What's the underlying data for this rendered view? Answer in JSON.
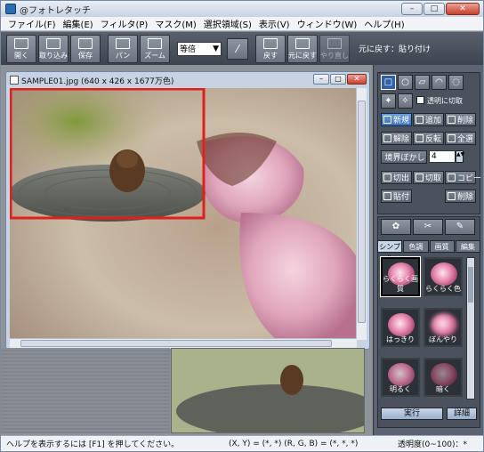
{
  "window": {
    "title": "@フォトレタッチ",
    "min": "–",
    "max": "□",
    "close": "✕"
  },
  "menu": [
    "ファイル(F)",
    "編集(E)",
    "フィルタ(P)",
    "マスク(M)",
    "選択領域(S)",
    "表示(V)",
    "ウィンドウ(W)",
    "ヘルプ(H)"
  ],
  "toolbar": {
    "open": "開く",
    "import": "取り込み",
    "save": "保存",
    "pan": "パン",
    "zoom": "ズーム",
    "zoom_value": "等倍",
    "back": "戻す",
    "undo": "元に戻す",
    "redo": "やり直し",
    "undo_label": "元に戻す：貼り付け"
  },
  "doc": {
    "title": "SAMPLE01.jpg (640 x 426 x 1677万色)"
  },
  "tools": {
    "transparent_cut": "透明に切取",
    "new": "新規",
    "add": "追加",
    "delete": "削除",
    "clear": "解除",
    "invert": "反転",
    "all": "全選",
    "border_blur": "境界ぼかし",
    "blur_value": "4",
    "cut": "切出",
    "trim": "切取",
    "copy": "コピー",
    "paste": "貼付",
    "erase": "削除"
  },
  "tabs": [
    "シンプル",
    "色調",
    "画質",
    "編集"
  ],
  "filters": [
    {
      "label": "らくらく画質"
    },
    {
      "label": "らくらく色"
    },
    {
      "label": "はっきり"
    },
    {
      "label": "ぼんやり"
    },
    {
      "label": "明るく"
    },
    {
      "label": "暗く"
    }
  ],
  "actions": {
    "run": "実行",
    "detail": "詳細"
  },
  "status": {
    "help": "ヘルプを表示するには [F1] を押してください。",
    "coords": "(X, Y) = (*, *)  (R, G, B) = (*, *, *)",
    "transparency": "透明度(0~100)：*"
  },
  "colors": {
    "accent": "#3a6db0",
    "selection": "#e0201c"
  }
}
